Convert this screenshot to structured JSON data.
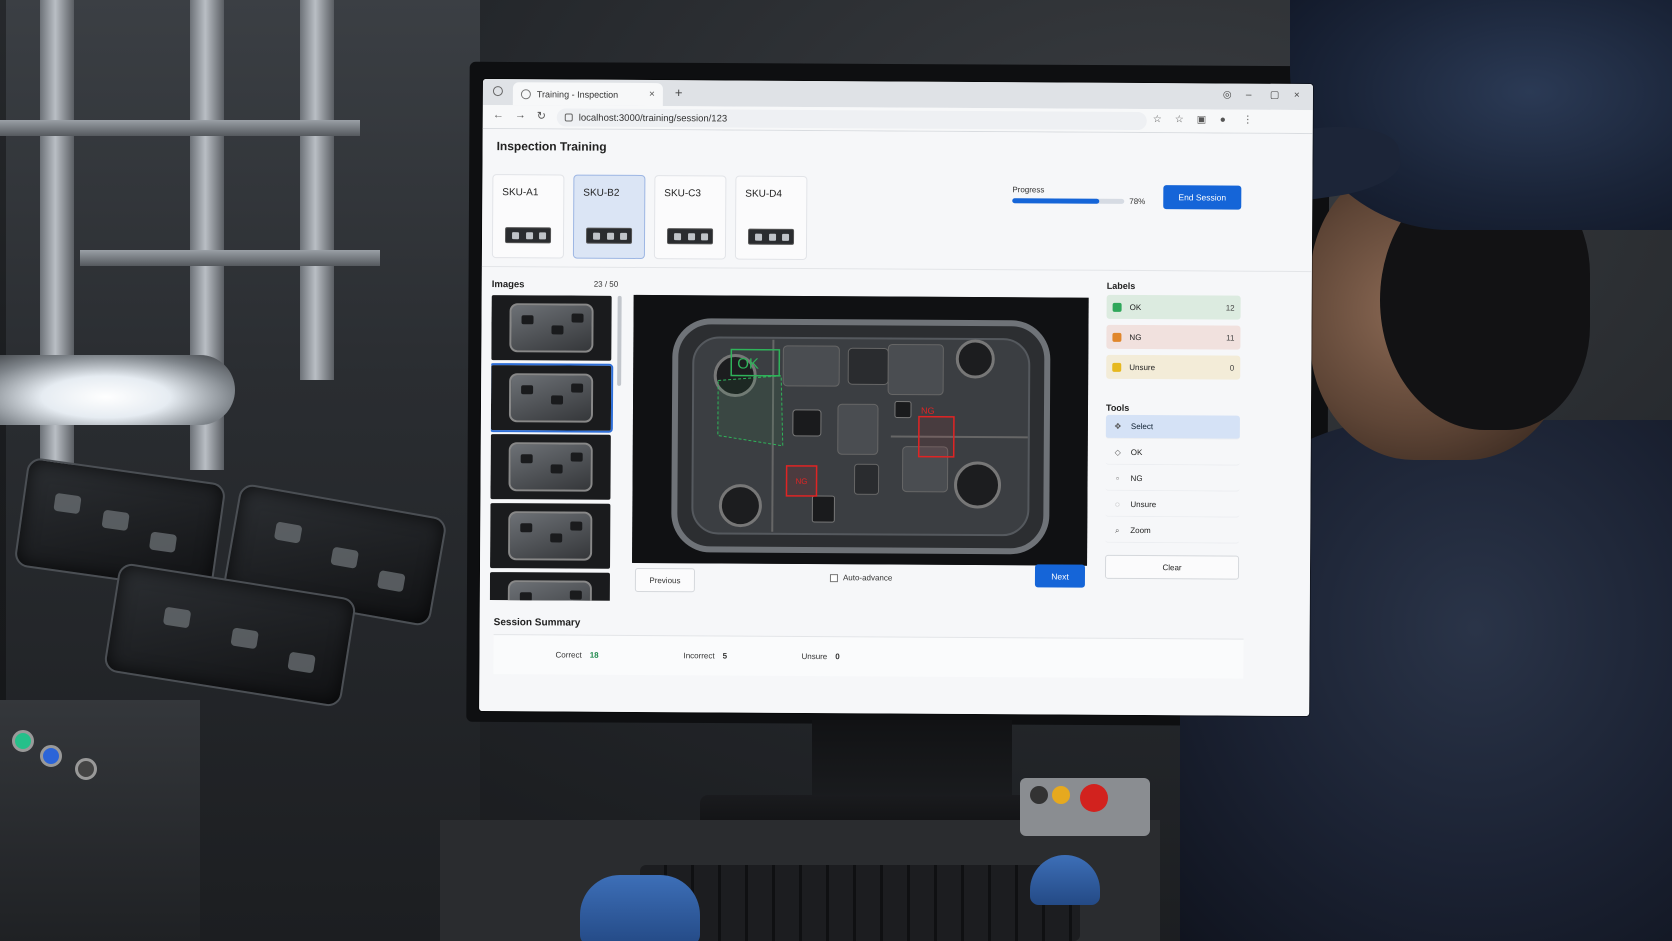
{
  "browser": {
    "tab_title": "Training - Inspection",
    "tab_close": "×",
    "new_tab": "+",
    "url": "localhost:3000/training/session/123",
    "nav_back": "←",
    "nav_forward": "→",
    "nav_reload": "↻",
    "window_minimize": "–",
    "window_restore": "▢",
    "window_close": "×"
  },
  "page": {
    "title": "Inspection Training"
  },
  "skus": [
    {
      "label": "SKU-A1",
      "selected": false
    },
    {
      "label": "SKU-B2",
      "selected": true
    },
    {
      "label": "SKU-C3",
      "selected": false
    },
    {
      "label": "SKU-D4",
      "selected": false
    }
  ],
  "progress": {
    "label": "Progress",
    "percent_text": "78%",
    "value": 0.78
  },
  "end_session_label": "End Session",
  "images": {
    "title": "Images",
    "count": "23 / 50",
    "active_index": 1
  },
  "viewer": {
    "annotations": [
      {
        "label": "OK",
        "color": "#2fb35a"
      },
      {
        "label": "NG",
        "color": "#e02424"
      },
      {
        "label": "NG",
        "color": "#e02424"
      }
    ]
  },
  "controls": {
    "previous_label": "Previous",
    "auto_advance_label": "Auto-advance",
    "next_label": "Next"
  },
  "labels": {
    "title": "Labels",
    "items": [
      {
        "name": "OK",
        "count": "12",
        "color": "#2fa75a"
      },
      {
        "name": "NG",
        "count": "11",
        "color": "#e0862b"
      },
      {
        "name": "Unsure",
        "count": "0",
        "color": "#e6b81f"
      }
    ]
  },
  "tools": {
    "title": "Tools",
    "items": [
      {
        "name": "Select",
        "icon": "cursor-icon",
        "glyph": "✥",
        "active": true
      },
      {
        "name": "OK",
        "icon": "check-tag-icon",
        "glyph": "◇",
        "active": false
      },
      {
        "name": "NG",
        "icon": "flag-icon",
        "glyph": "▫",
        "active": false
      },
      {
        "name": "Unsure",
        "icon": "question-icon",
        "glyph": "◌",
        "active": false
      },
      {
        "name": "Zoom",
        "icon": "magnifier-icon",
        "glyph": "⌕",
        "active": false
      }
    ],
    "clear_label": "Clear"
  },
  "summary": {
    "title": "Session Summary",
    "correct_label": "Correct",
    "correct_value": "18",
    "incorrect_label": "Incorrect",
    "incorrect_value": "5",
    "unsure_label": "Unsure",
    "unsure_value": "0"
  },
  "colors": {
    "accent": "#1565d8",
    "ok": "#2fb35a",
    "ng": "#e02424"
  }
}
